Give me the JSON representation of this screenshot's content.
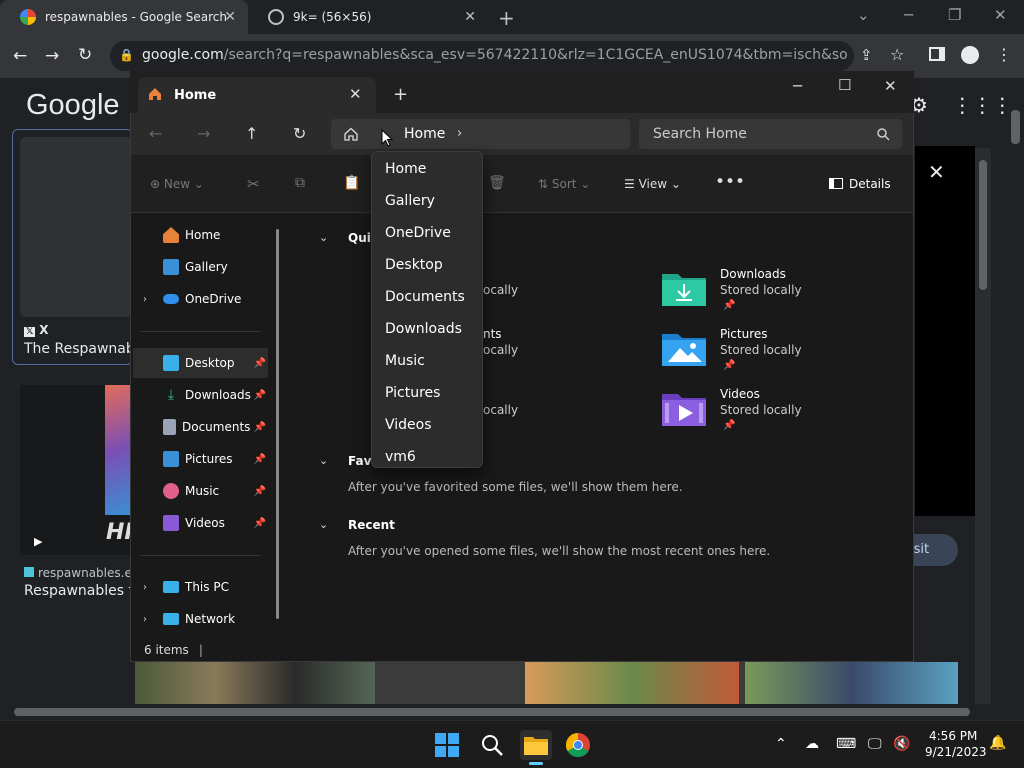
{
  "browser": {
    "tabs": [
      {
        "title": "respawnables - Google Search",
        "favicon": "google-icon",
        "active": true
      },
      {
        "title": "9k= (56×56)",
        "favicon": "globe-icon",
        "active": false
      }
    ],
    "url_host": "google.com",
    "url_rest": "/search?q=respawnables&sca_esv=567422110&rlz=1C1GCEA_enUS1074&tbm=isch&source=iu&ict..."
  },
  "google": {
    "logo": "Google",
    "card_source": "X",
    "card_title": "The Respawnables",
    "result_site": "respawnables.en",
    "result_title": "Respawnables fo",
    "visit_label": "isit",
    "poster_text": "HI"
  },
  "explorer": {
    "tab_title": "Home",
    "address": "Home",
    "search_placeholder": "Search Home",
    "commands": {
      "new": "New",
      "sort": "Sort",
      "view": "View",
      "details": "Details"
    },
    "nav": [
      {
        "label": "Home",
        "icon": "home-icon",
        "color": "#e8823a"
      },
      {
        "label": "Gallery",
        "icon": "gallery-icon",
        "color": "#3a8fd6"
      },
      {
        "label": "OneDrive",
        "icon": "cloud-icon",
        "color": "#2f8fea",
        "expandable": true
      },
      {
        "label": "Desktop",
        "icon": "desktop-icon",
        "color": "#3ab0e8",
        "pinned": true,
        "selected": true
      },
      {
        "label": "Downloads",
        "icon": "download-icon",
        "color": "#2ebe8f",
        "pinned": true
      },
      {
        "label": "Documents",
        "icon": "document-icon",
        "color": "#9aa4b6",
        "pinned": true
      },
      {
        "label": "Pictures",
        "icon": "pictures-icon",
        "color": "#3a8fd6",
        "pinned": true
      },
      {
        "label": "Music",
        "icon": "music-icon",
        "color": "#e0608a",
        "pinned": true
      },
      {
        "label": "Videos",
        "icon": "videos-icon",
        "color": "#8a5ad6",
        "pinned": true
      },
      {
        "label": "This PC",
        "icon": "pc-icon",
        "color": "#3ab0e8",
        "expandable": true
      },
      {
        "label": "Network",
        "icon": "network-icon",
        "color": "#3ab0e8",
        "expandable": true
      }
    ],
    "sections": {
      "quick_access": "Quic",
      "favorites": "Favo",
      "favorites_hint": "After you've favorited some files, we'll show them here.",
      "recent": "Recent",
      "recent_hint": "After you've opened some files, we'll show the most recent ones here."
    },
    "quick_items_partial": [
      {
        "name": "",
        "sub": "ocally"
      },
      {
        "name": "nts",
        "sub": "ocally"
      },
      {
        "name": "",
        "sub": "ocally"
      }
    ],
    "quick_items": [
      {
        "name": "Downloads",
        "sub": "Stored locally",
        "icon": "downloads-folder-icon"
      },
      {
        "name": "Pictures",
        "sub": "Stored locally",
        "icon": "pictures-folder-icon"
      },
      {
        "name": "Videos",
        "sub": "Stored locally",
        "icon": "videos-folder-icon"
      }
    ],
    "status": "6 items",
    "dropdown": [
      "Home",
      "Gallery",
      "OneDrive",
      "Desktop",
      "Documents",
      "Downloads",
      "Music",
      "Pictures",
      "Videos",
      "vm6"
    ]
  },
  "taskbar": {
    "time": "4:56 PM",
    "date": "9/21/2023"
  }
}
